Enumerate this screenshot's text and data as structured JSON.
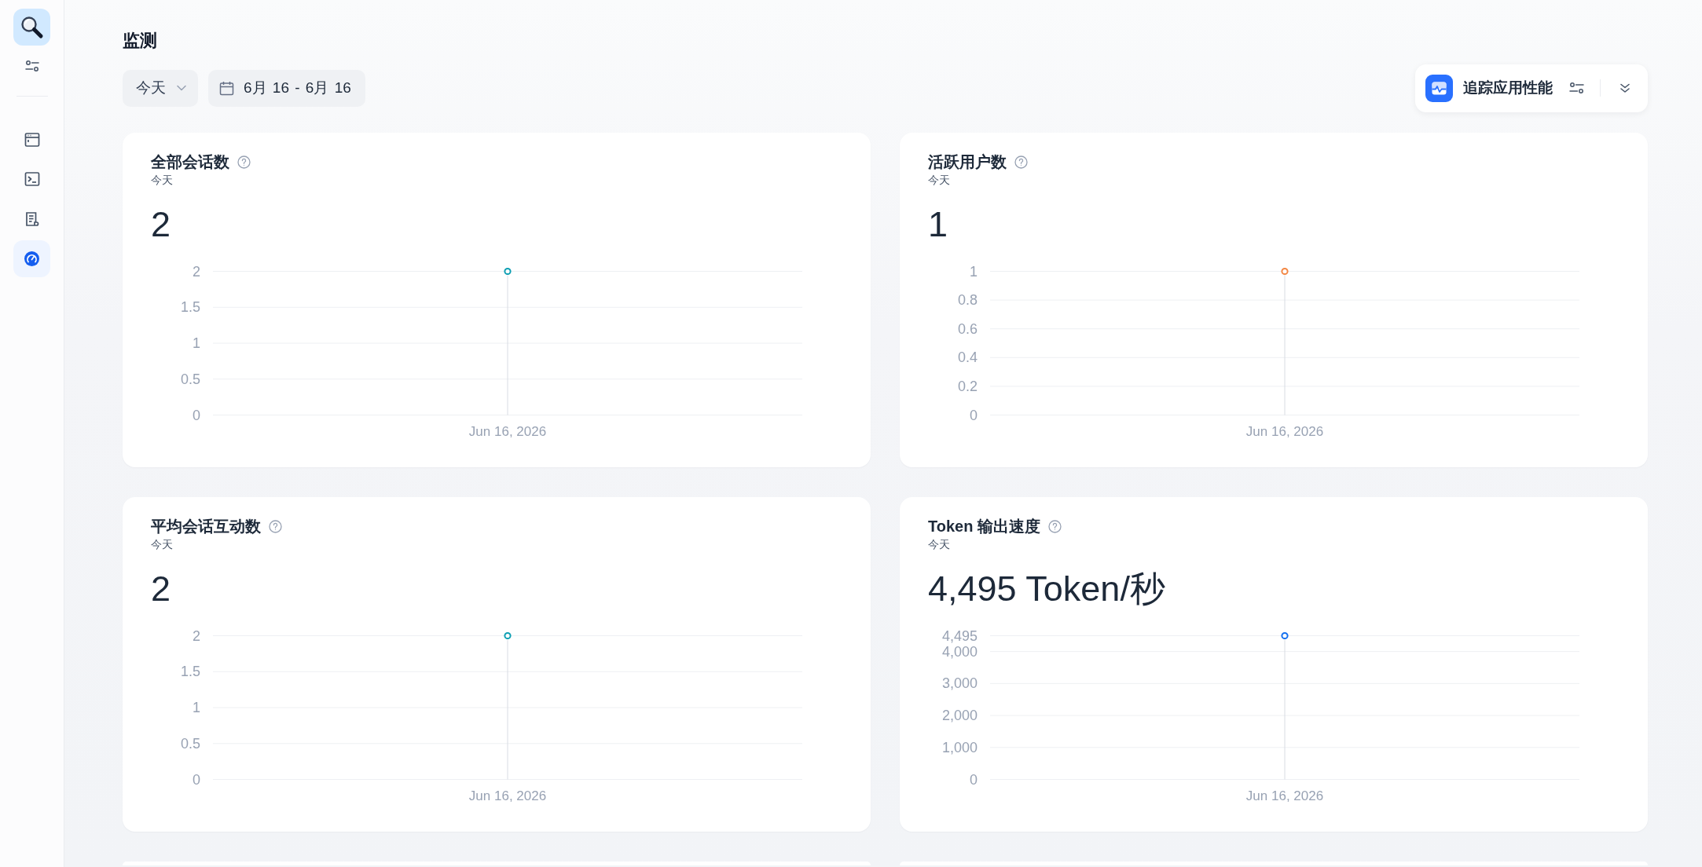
{
  "sidebar": {
    "nav": [
      {
        "selected": false
      },
      {
        "selected": false
      },
      {
        "selected": false
      },
      {
        "selected": true
      }
    ]
  },
  "header": {
    "title": "监测"
  },
  "filters": {
    "period": "今天",
    "date_range": "6月 16 - 6月 16"
  },
  "tracing": {
    "label": "追踪应用性能"
  },
  "cards": [
    {
      "kind": "metric",
      "title": "全部会话数",
      "subtitle": "今天",
      "value": "2",
      "chart_data": {
        "type": "scatter",
        "categories": [
          "Jun 16, 2026"
        ],
        "series": [
          {
            "color": "#0e9fb3",
            "values": [
              2
            ]
          }
        ],
        "ylim": [
          0,
          2
        ],
        "yticks": [
          0,
          0.5,
          1,
          1.5,
          2
        ],
        "grid": true
      }
    },
    {
      "kind": "metric",
      "title": "活跃用户数",
      "subtitle": "今天",
      "value": "1",
      "chart_data": {
        "type": "scatter",
        "categories": [
          "Jun 16, 2026"
        ],
        "series": [
          {
            "color": "#f38744",
            "values": [
              1
            ]
          }
        ],
        "ylim": [
          0,
          1
        ],
        "yticks": [
          0,
          0.2,
          0.4,
          0.6,
          0.8,
          1
        ],
        "grid": true
      }
    },
    {
      "kind": "metric",
      "title": "平均会话互动数",
      "subtitle": "今天",
      "value": "2",
      "chart_data": {
        "type": "scatter",
        "categories": [
          "Jun 16, 2026"
        ],
        "series": [
          {
            "color": "#0e9fb3",
            "values": [
              2
            ]
          }
        ],
        "ylim": [
          0,
          2
        ],
        "yticks": [
          0,
          0.5,
          1,
          1.5,
          2
        ],
        "grid": true
      }
    },
    {
      "kind": "metric",
      "title": "Token 输出速度",
      "subtitle": "今天",
      "value": "4,495 Token/秒",
      "chart_data": {
        "type": "scatter",
        "categories": [
          "Jun 16, 2026"
        ],
        "series": [
          {
            "color": "#1570ef",
            "values": [
              4495
            ]
          }
        ],
        "ylim": [
          0,
          4495
        ],
        "yticks": [
          0,
          {
            "value": 1000,
            "label": "1,000"
          },
          {
            "value": 2000,
            "label": "2,000"
          },
          {
            "value": 3000,
            "label": "3,000"
          },
          {
            "value": 4000,
            "label": "4,000"
          },
          {
            "value": 4495,
            "label": "4,495"
          }
        ],
        "grid": true
      }
    },
    {
      "kind": "cut_off"
    },
    {
      "kind": "cut_off"
    }
  ]
}
